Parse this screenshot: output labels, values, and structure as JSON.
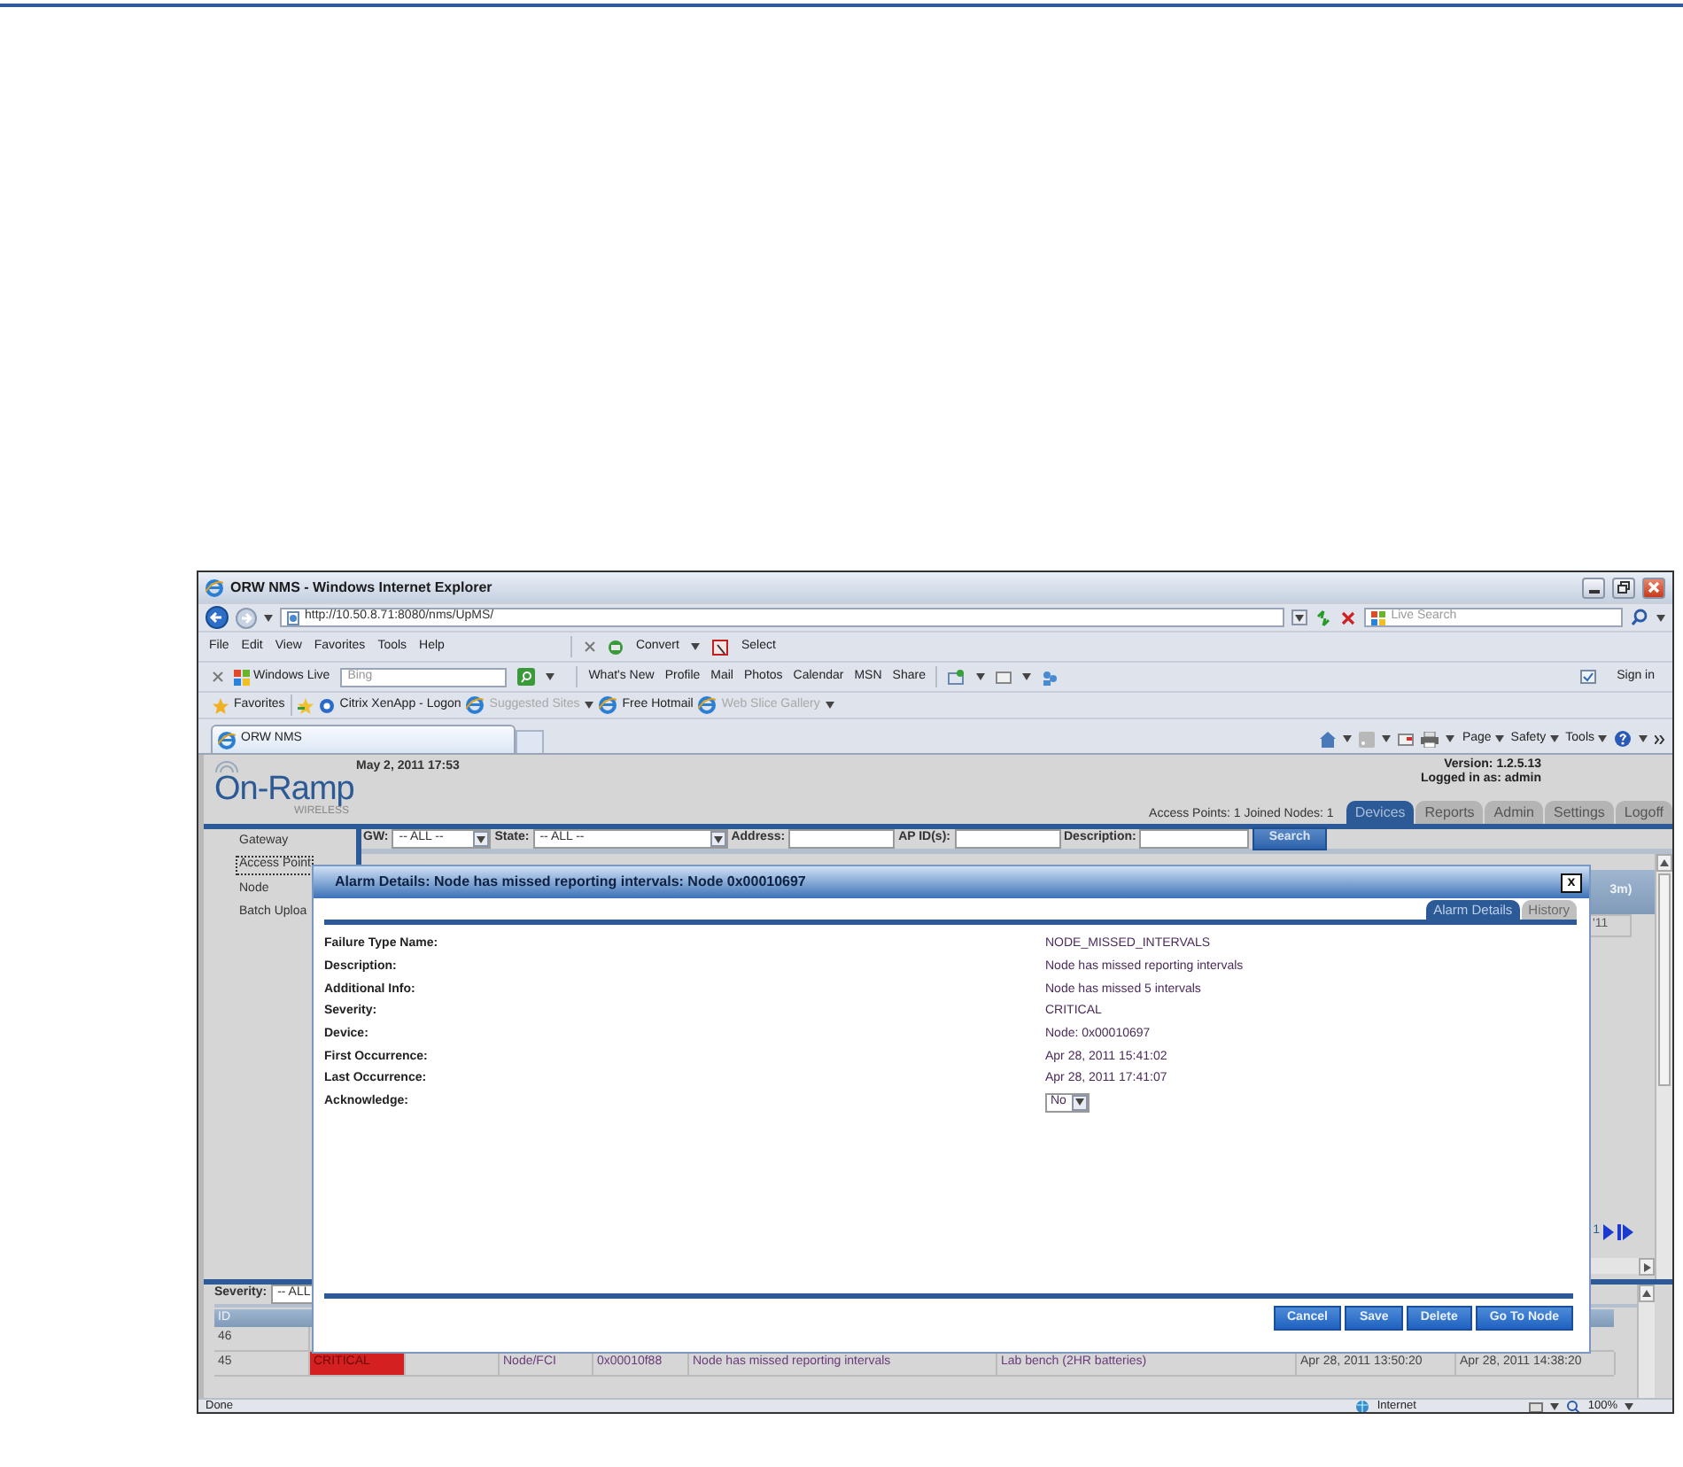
{
  "browser": {
    "title": "ORW NMS - Windows Internet Explorer",
    "address": "http://10.50.8.71:8080/nms/UpMS/",
    "search_placeholder": "Live Search",
    "menu": [
      "File",
      "Edit",
      "View",
      "Favorites",
      "Tools",
      "Help"
    ],
    "commands": [
      "Convert",
      "Select"
    ],
    "live": {
      "brand": "Windows Live",
      "search_placeholder": "Bing",
      "links": [
        "What's New",
        "Profile",
        "Mail",
        "Photos",
        "Calendar",
        "MSN",
        "Share"
      ],
      "sign_in": "Sign in"
    },
    "favorites": {
      "label": "Favorites",
      "links": [
        {
          "label": "Citrix XenApp - Logon",
          "disabled": false,
          "dropdown": false
        },
        {
          "label": "Suggested Sites",
          "disabled": true,
          "dropdown": true
        },
        {
          "label": "Free Hotmail",
          "disabled": false,
          "dropdown": false
        },
        {
          "label": "Web Slice Gallery",
          "disabled": true,
          "dropdown": true
        }
      ]
    },
    "tab": "ORW NMS",
    "tools": [
      "Page",
      "Safety",
      "Tools"
    ],
    "status": {
      "text": "Done",
      "zone": "Internet",
      "zoom": "100%"
    }
  },
  "app": {
    "logo": {
      "name": "On-Ramp",
      "tagline": "WIRELESS"
    },
    "date": "May 2, 2011 17:53",
    "version": "Version: 1.2.5.13",
    "login": "Logged in as: admin",
    "counts": "Access Points: 1 Joined Nodes: 1",
    "tabs": [
      {
        "label": "Devices",
        "selected": true
      },
      {
        "label": "Reports",
        "selected": false
      },
      {
        "label": "Admin",
        "selected": false
      },
      {
        "label": "Settings",
        "selected": false
      },
      {
        "label": "Logoff",
        "selected": false
      }
    ],
    "nav": [
      {
        "label": "Gateway",
        "selected": false
      },
      {
        "label": "Access Point",
        "selected": true
      },
      {
        "label": "Node",
        "selected": false
      },
      {
        "label": "Batch Uploa",
        "selected": false
      }
    ],
    "filters": [
      {
        "label": "GW:",
        "kind": "select",
        "value": "-- ALL --"
      },
      {
        "label": "State:",
        "kind": "select",
        "value": "-- ALL --"
      },
      {
        "label": "Address:",
        "kind": "input"
      },
      {
        "label": "AP ID(s):",
        "kind": "input"
      },
      {
        "label": "Description:",
        "kind": "input"
      }
    ],
    "search_button": "Search",
    "device_table": {
      "column_header": "3m)",
      "cell": "'11"
    },
    "pager": {
      "page": "1"
    },
    "severity_filter": {
      "label": "Severity:",
      "value": "-- ALL"
    },
    "alarm_table": {
      "columns": [
        "ID"
      ],
      "rows": [
        {
          "id": "46"
        },
        {
          "id": "45",
          "severity": "CRITICAL",
          "color": "#d42020",
          "type": "Node/FCI",
          "address": "0x00010f88",
          "description": "Node has missed reporting intervals",
          "location": "Lab bench (2HR batteries)",
          "first": "Apr 28, 2011 13:50:20",
          "last": "Apr 28, 2011 14:38:20"
        }
      ]
    }
  },
  "dialog": {
    "title": "Alarm Details: Node has missed reporting intervals: Node 0x00010697",
    "close": "x",
    "tabs": [
      {
        "label": "Alarm Details",
        "selected": true
      },
      {
        "label": "History",
        "selected": false
      }
    ],
    "fields": [
      {
        "label": "Failure Type Name:",
        "kind": "text",
        "value": "NODE_MISSED_INTERVALS"
      },
      {
        "label": "Description:",
        "kind": "text",
        "value": "Node has missed reporting intervals"
      },
      {
        "label": "Additional Info:",
        "kind": "text",
        "value": "Node has missed 5 intervals"
      },
      {
        "label": "Severity:",
        "kind": "text",
        "value": "CRITICAL"
      },
      {
        "label": "Device:",
        "kind": "text",
        "value": "Node: 0x00010697"
      },
      {
        "label": "First Occurrence:",
        "kind": "text",
        "value": "Apr 28, 2011 15:41:02"
      },
      {
        "label": "Last Occurrence:",
        "kind": "text",
        "value": "Apr 28, 2011 17:41:07"
      },
      {
        "label": "Acknowledge:",
        "kind": "select",
        "value": "No"
      }
    ],
    "buttons": [
      "Cancel",
      "Save",
      "Delete",
      "Go To Node"
    ]
  }
}
